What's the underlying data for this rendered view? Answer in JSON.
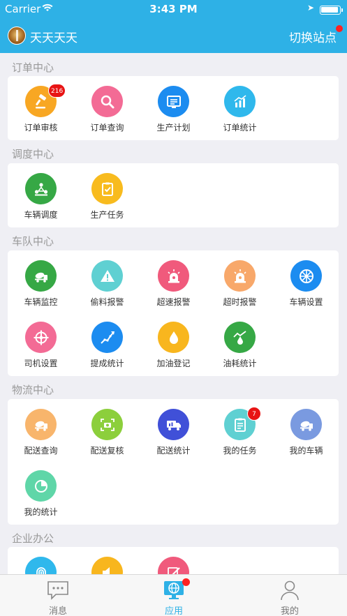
{
  "status": {
    "carrier": "Carrier",
    "time": "3:43 PM"
  },
  "header": {
    "user_name": "天天天天",
    "switch_label": "切换站点"
  },
  "sections": {
    "orders": {
      "title": "订单中心",
      "items": [
        {
          "label": "订单审核",
          "icon": "gavel-icon",
          "color": "#f8a723",
          "badge": "216"
        },
        {
          "label": "订单查询",
          "icon": "search-icon",
          "color": "#f36b95"
        },
        {
          "label": "生产计划",
          "icon": "plan-list-icon",
          "color": "#1c8cf0"
        },
        {
          "label": "订单统计",
          "icon": "bar-chart-icon",
          "color": "#2fb8ec"
        }
      ]
    },
    "dispatch": {
      "title": "调度中心",
      "items": [
        {
          "label": "车辆调度",
          "icon": "people-network-icon",
          "color": "#36a845"
        },
        {
          "label": "生产任务",
          "icon": "clipboard-check-icon",
          "color": "#f8bb1e"
        }
      ]
    },
    "fleet": {
      "title": "车队中心",
      "items": [
        {
          "label": "车辆监控",
          "icon": "mixer-truck-icon",
          "color": "#36a845"
        },
        {
          "label": "偷料报警",
          "icon": "warning-icon",
          "color": "#5fd0d2"
        },
        {
          "label": "超速报警",
          "icon": "siren-icon",
          "color": "#f05a7c"
        },
        {
          "label": "超时报警",
          "icon": "siren-icon",
          "color": "#f8a86a"
        },
        {
          "label": "车辆设置",
          "icon": "wheel-icon",
          "color": "#1c8cf0"
        },
        {
          "label": "司机设置",
          "icon": "steering-wheel-icon",
          "color": "#f36b95"
        },
        {
          "label": "提成统计",
          "icon": "trend-line-icon",
          "color": "#1c8cf0"
        },
        {
          "label": "加油登记",
          "icon": "fuel-drop-icon",
          "color": "#f8b61e"
        },
        {
          "label": "油耗统计",
          "icon": "fuel-trend-icon",
          "color": "#36a845"
        }
      ]
    },
    "logistics": {
      "title": "物流中心",
      "items": [
        {
          "label": "配送查询",
          "icon": "mixer-truck-icon",
          "color": "#f8b56c"
        },
        {
          "label": "配送复核",
          "icon": "scan-camera-icon",
          "color": "#8ccf3c"
        },
        {
          "label": "配送统计",
          "icon": "delivery-truck-icon",
          "color": "#4050d8"
        },
        {
          "label": "我的任务",
          "icon": "task-list-icon",
          "color": "#5fd0d2",
          "badge": "7"
        },
        {
          "label": "我的车辆",
          "icon": "mixer-truck-icon",
          "color": "#7a9ae0"
        },
        {
          "label": "我的统计",
          "icon": "pie-chart-icon",
          "color": "#5fd6a8"
        }
      ]
    },
    "office": {
      "title": "企业办公",
      "items": [
        {
          "label": "",
          "icon": "fingerprint-icon",
          "color": "#2fb8ec"
        },
        {
          "label": "",
          "icon": "speaker-icon",
          "color": "#f8b61e"
        },
        {
          "label": "",
          "icon": "edit-icon",
          "color": "#f05a7c"
        }
      ]
    }
  },
  "tabbar": {
    "items": [
      {
        "label": "消息",
        "icon": "chat-bubble-icon"
      },
      {
        "label": "应用",
        "icon": "globe-monitor-icon",
        "active": true
      },
      {
        "label": "我的",
        "icon": "person-icon"
      }
    ]
  },
  "colors": {
    "primary": "#2eb1e6",
    "badge": "#e81414"
  }
}
